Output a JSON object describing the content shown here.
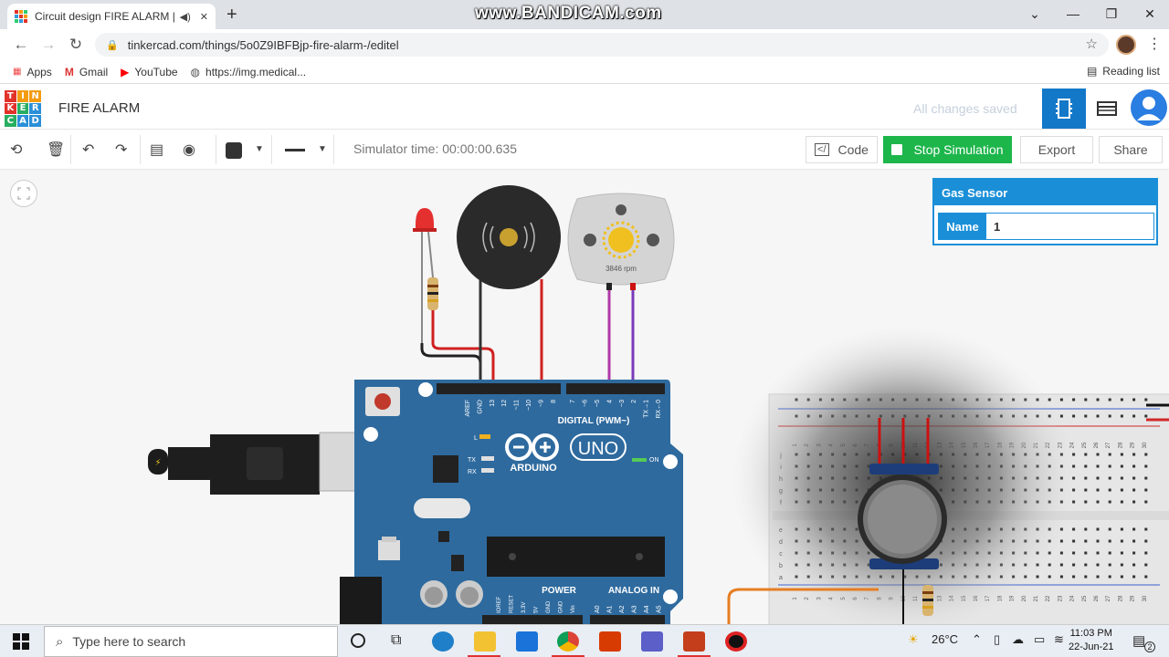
{
  "browser": {
    "tab_title": "Circuit design FIRE ALARM |",
    "url": "tinkercad.com/things/5o0Z9IBFBjp-fire-alarm-/editel",
    "watermark": "www.BANDICAM.com",
    "bookmarks": [
      {
        "label": "Apps",
        "icon": "apps-grid-icon"
      },
      {
        "label": "Gmail",
        "icon": "gmail-icon"
      },
      {
        "label": "YouTube",
        "icon": "youtube-icon"
      },
      {
        "label": "https://img.medical...",
        "icon": "globe-icon"
      }
    ],
    "reading_list": "Reading list"
  },
  "tinkercad": {
    "logo_letters": [
      "T",
      "I",
      "N",
      "K",
      "E",
      "R",
      "C",
      "A",
      "D"
    ],
    "project_name": "FIRE ALARM",
    "save_status": "All changes saved"
  },
  "toolbar": {
    "simulator_time": "Simulator time: 00:00:00.635",
    "code_label": "Code",
    "stop_label": "Stop Simulation",
    "export_label": "Export",
    "share_label": "Share"
  },
  "inspector": {
    "title": "Gas Sensor",
    "name_label": "Name",
    "name_value": "1"
  },
  "circuit": {
    "motor_rpm": "3846 rpm",
    "board_name": "ARDUINO",
    "board_model": "UNO",
    "digital_label": "DIGITAL (PWM~)",
    "power_label": "POWER",
    "analog_label": "ANALOG IN",
    "on_label": "ON",
    "tx_label": "TX",
    "rx_label": "RX",
    "l_label": "L",
    "top_pins": [
      "AREF",
      "GND",
      "13",
      "12",
      "~11",
      "~10",
      "~9",
      "8",
      "7",
      "~6",
      "~5",
      "4",
      "~3",
      "2",
      "TX→1",
      "RX←0"
    ],
    "power_pins": [
      "IOREF",
      "RESET",
      "3.3V",
      "5V",
      "GND",
      "GND",
      "Vin"
    ],
    "analog_pins": [
      "A0",
      "A1",
      "A2",
      "A3",
      "A4",
      "A5"
    ],
    "bb_numbers": [
      "1",
      "2",
      "3",
      "4",
      "5",
      "6",
      "7",
      "8",
      "9",
      "10",
      "11",
      "12",
      "13",
      "14",
      "15",
      "16",
      "17",
      "18",
      "19",
      "20",
      "21",
      "22",
      "23",
      "24",
      "25",
      "26",
      "27",
      "28",
      "29",
      "30"
    ],
    "bb_rows_top": [
      "j",
      "i",
      "h",
      "g",
      "f"
    ],
    "bb_rows_bottom": [
      "e",
      "d",
      "c",
      "b",
      "a"
    ]
  },
  "taskbar": {
    "search_placeholder": "Type here to search",
    "temperature": "26°C",
    "time": "11:03 PM",
    "date": "22-Jun-21",
    "notif_count": "2"
  },
  "colors": {
    "accent": "#1a8fd8",
    "stop_green": "#1db64b",
    "arduino_blue": "#2e6a9e"
  }
}
